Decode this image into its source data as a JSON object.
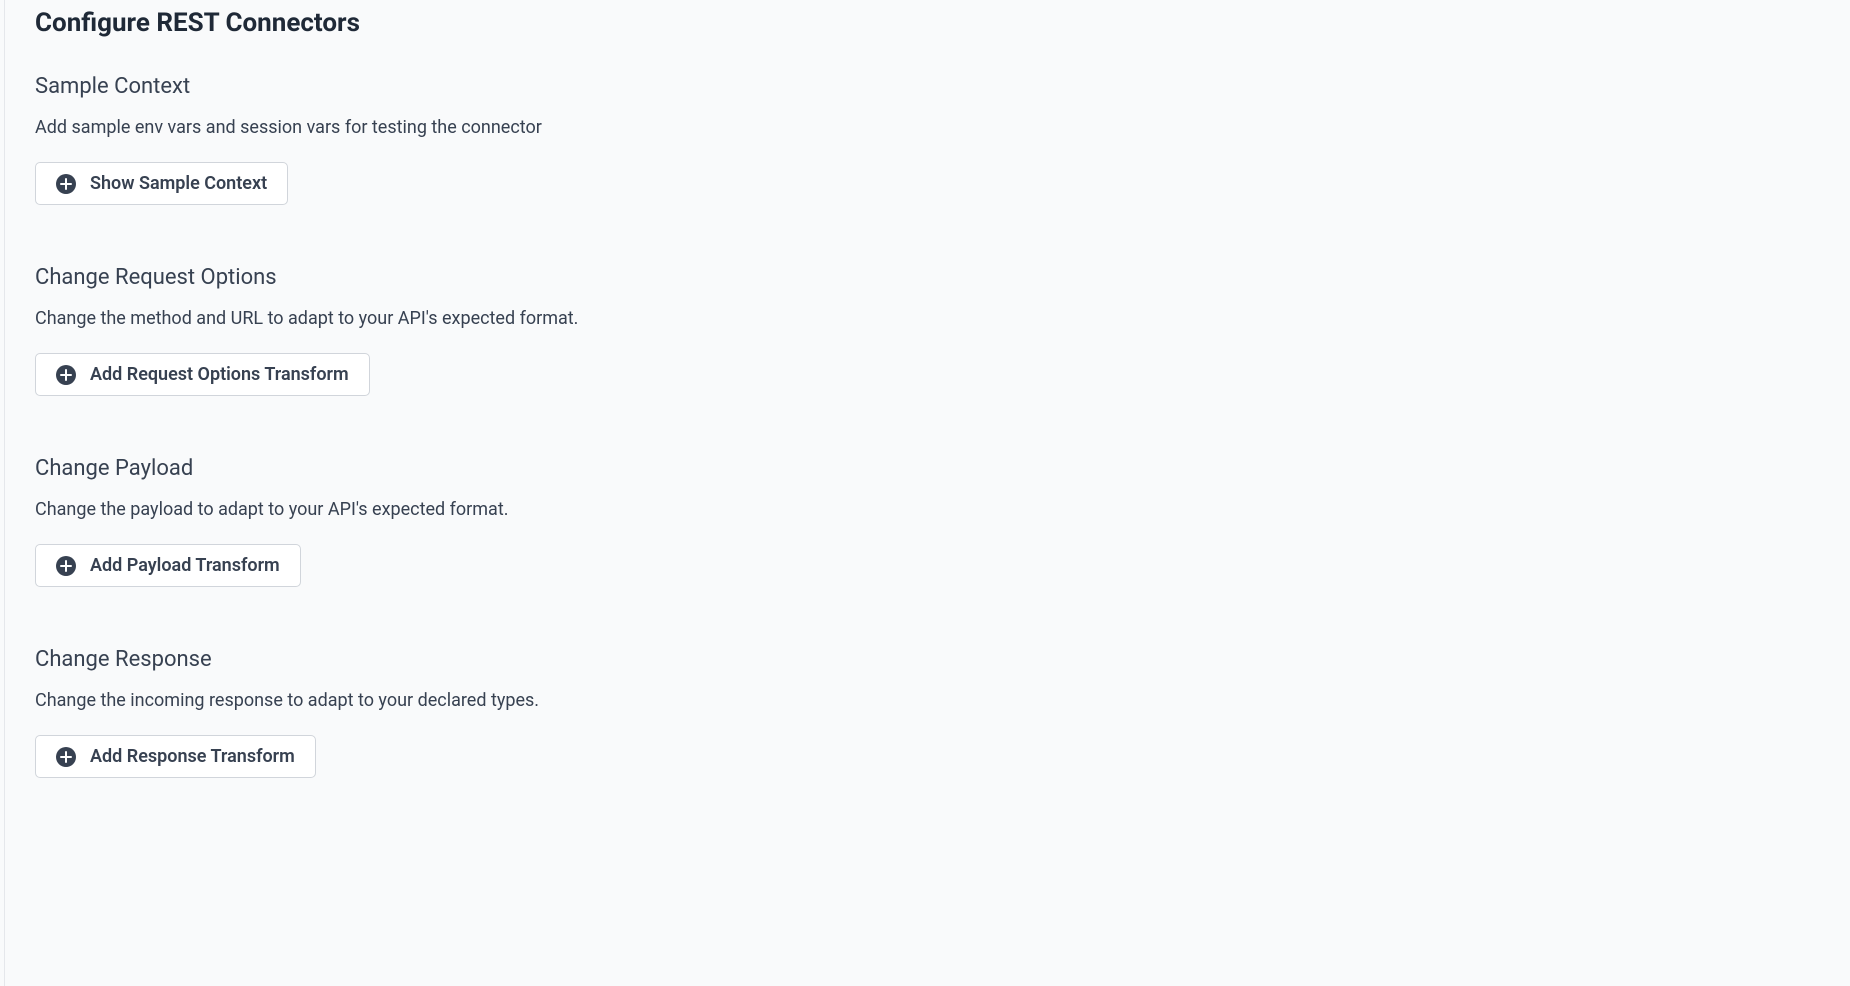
{
  "page": {
    "title": "Configure REST Connectors"
  },
  "sections": {
    "sample_context": {
      "title": "Sample Context",
      "description": "Add sample env vars and session vars for testing the connector",
      "button_label": "Show Sample Context"
    },
    "request_options": {
      "title": "Change Request Options",
      "description": "Change the method and URL to adapt to your API's expected format.",
      "button_label": "Add Request Options Transform"
    },
    "payload": {
      "title": "Change Payload",
      "description": "Change the payload to adapt to your API's expected format.",
      "button_label": "Add Payload Transform"
    },
    "response": {
      "title": "Change Response",
      "description": "Change the incoming response to adapt to your declared types.",
      "button_label": "Add Response Transform"
    }
  }
}
